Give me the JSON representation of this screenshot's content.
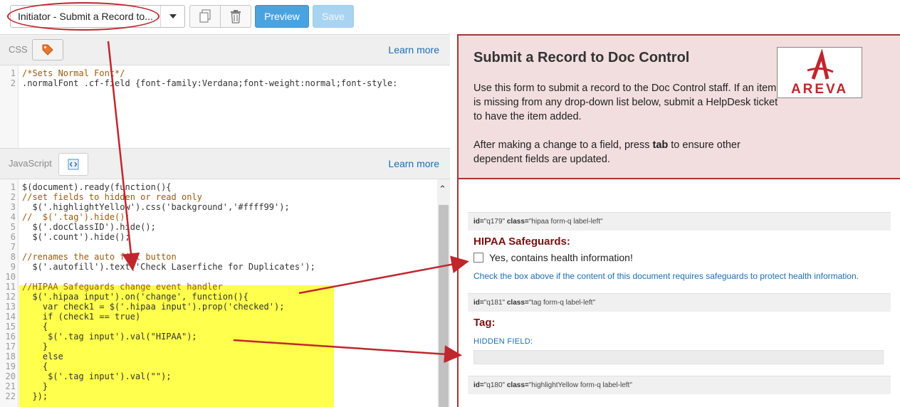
{
  "toolbar": {
    "form_select_value": "Initiator - Submit a Record to...",
    "preview_label": "Preview",
    "save_label": "Save"
  },
  "css_section": {
    "title": "CSS",
    "learn_more": "Learn more",
    "lines": [
      {
        "n": "1",
        "text": "/*Sets Normal Font*/",
        "color": "#9b5b0b"
      },
      {
        "n": "2",
        "text": ".normalFont .cf-field {font-family:Verdana;font-weight:normal;font-style:",
        "color": "#333333"
      }
    ]
  },
  "js_section": {
    "title": "JavaScript",
    "learn_more": "Learn more",
    "lines": [
      {
        "n": "1",
        "text": "$(document).ready(function(){"
      },
      {
        "n": "2",
        "text": "//set fields to hidden or read only"
      },
      {
        "n": "3",
        "text": "  $('.highlightYellow').css('background','#ffff99');"
      },
      {
        "n": "4",
        "text": "//  $('.tag').hide();"
      },
      {
        "n": "5",
        "text": "  $('.docClassID').hide();"
      },
      {
        "n": "6",
        "text": "  $('.count').hide();"
      },
      {
        "n": "7",
        "text": ""
      },
      {
        "n": "8",
        "text": "//renames the auto fill button"
      },
      {
        "n": "9",
        "text": "  $('.autofill').text('Check Laserfiche for Duplicates');"
      },
      {
        "n": "10",
        "text": ""
      },
      {
        "n": "11",
        "text": "//HIPAA Safeguards change event handler"
      },
      {
        "n": "12",
        "text": "  $('.hipaa input').on('change', function(){"
      },
      {
        "n": "13",
        "text": "    var check1 = $('.hipaa input').prop('checked');"
      },
      {
        "n": "14",
        "text": "    if (check1 == true)"
      },
      {
        "n": "15",
        "text": "    {"
      },
      {
        "n": "16",
        "text": "     $('.tag input').val(\"HIPAA\");"
      },
      {
        "n": "17",
        "text": "    }"
      },
      {
        "n": "18",
        "text": "    else"
      },
      {
        "n": "19",
        "text": "    {"
      },
      {
        "n": "20",
        "text": "     $('.tag input').val(\"\");"
      },
      {
        "n": "21",
        "text": "    }"
      },
      {
        "n": "22",
        "text": "  });"
      }
    ]
  },
  "form": {
    "title": "Submit a Record to Doc Control",
    "desc1": "Use this form to submit a record to the Doc Control staff. If an item is missing from any drop-down list below, submit a HelpDesk ticket to have the item added.",
    "desc2_pre": "After making a change to a field, press ",
    "desc2_bold": "tab",
    "desc2_post": " to ensure other dependent fields are updated.",
    "logo_text": "AREVA",
    "fields": [
      {
        "id_label": "id=",
        "id_value": "\"q179\"",
        "class_label": "class=",
        "class_value": "\"hipaa form-q label-left\""
      },
      {
        "id_label": "id=",
        "id_value": "\"q181\"",
        "class_label": "class=",
        "class_value": "\"tag form-q label-left\""
      },
      {
        "id_label": "id=",
        "id_value": "\"q180\"",
        "class_label": "class=",
        "class_value": "\"highlightYellow form-q label-left\""
      }
    ],
    "hipaa_label": "HIPAA Safeguards:",
    "hipaa_checkbox_text": "Yes, contains health information!",
    "hipaa_help": "Check the box above if the content of this document requires safeguards to protect health information.",
    "tag_label": "Tag:",
    "hidden_field_label": "HIDDEN FIELD:"
  },
  "colors": {
    "accent_red": "#c0262e",
    "highlight_yellow": "#ffff4d",
    "link_blue": "#1a6db5",
    "form_header_bg": "#f2dede"
  }
}
